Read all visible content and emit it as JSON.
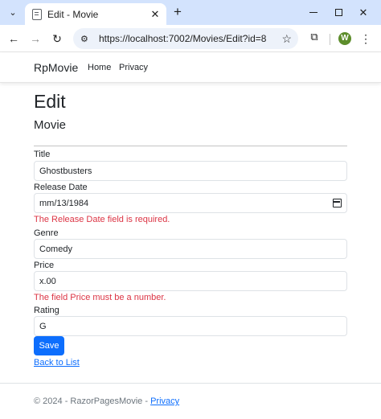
{
  "browser": {
    "tab_title": "Edit - Movie",
    "url": "https://localhost:7002/Movies/Edit?id=8",
    "profile_initial": "W"
  },
  "site": {
    "brand": "RpMovie",
    "nav": [
      "Home",
      "Privacy"
    ]
  },
  "page": {
    "title": "Edit",
    "subtitle": "Movie"
  },
  "form": {
    "title_label": "Title",
    "title_value": "Ghostbusters",
    "release_date_label": "Release Date",
    "release_date_value": "mm/13/1984",
    "release_date_error": "The Release Date field is required.",
    "genre_label": "Genre",
    "genre_value": "Comedy",
    "price_label": "Price",
    "price_value": "x.00",
    "price_error": "The field Price must be a number.",
    "rating_label": "Rating",
    "rating_value": "G",
    "save_label": "Save"
  },
  "back_link": "Back to List",
  "footer": {
    "text": "© 2024 - RazorPagesMovie -",
    "link": "Privacy"
  },
  "colors": {
    "accent": "#0d6efd",
    "error": "#dc3545",
    "tabstrip": "#d3e3fd"
  }
}
